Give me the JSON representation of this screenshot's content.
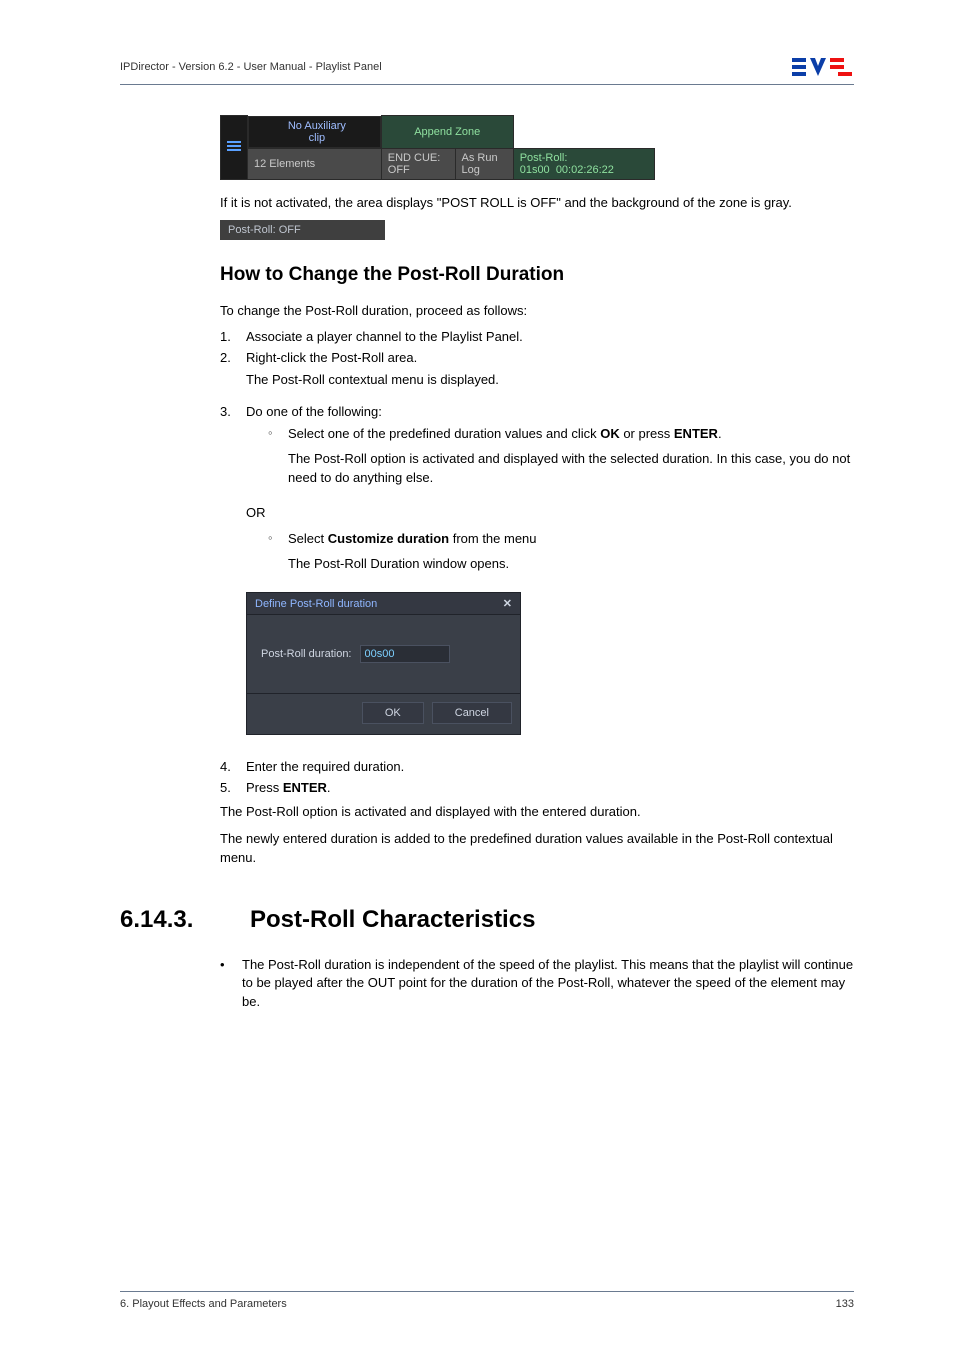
{
  "header": {
    "left": "IPDirector - Version 6.2 - User Manual - Playlist Panel"
  },
  "ui_bar": {
    "aux_label": "No Auxiliary clip",
    "append_label": "Append Zone",
    "elements": "12 Elements",
    "end_cue": "END CUE: OFF",
    "as_run": "As Run Log",
    "post_roll": "Post-Roll: 01s00",
    "timecode": "00:02:26:22"
  },
  "para_off": "If it is not activated, the area displays \"POST ROLL is OFF\" and the background of the zone is gray.",
  "post_roll_off_chip": "Post-Roll: OFF",
  "howto_heading": "How to Change the Post-Roll Duration",
  "howto_intro": "To change the Post-Roll duration, proceed as follows:",
  "steps": [
    {
      "n": "1.",
      "text": "Associate a player channel to the Playlist Panel."
    },
    {
      "n": "2.",
      "text": "Right-click the Post-Roll area."
    }
  ],
  "step2_sub": "The Post-Roll contextual menu is displayed.",
  "step3_lead": "Do one of the following:",
  "step3_n": "3.",
  "step3_sub1_pre": "Select one of the predefined duration values and click ",
  "ok_word": "OK",
  "or_press": " or press ",
  "enter_word": "ENTER",
  "step3_sub1_post": ".",
  "step3_sub1_expl": "The Post-Roll option is activated and displayed with the selected duration. In this case, you do not need to do anything else.",
  "or_label": "OR",
  "step3_sub2_pre": "Select ",
  "customize_word": "Customize duration",
  "step3_sub2_post": " from the menu",
  "step3_sub2_expl": "The Post-Roll Duration window opens.",
  "dialog": {
    "title": "Define Post-Roll duration",
    "field_label": "Post-Roll duration:",
    "field_value": "00s00",
    "ok": "OK",
    "cancel": "Cancel"
  },
  "step4": {
    "n": "4.",
    "text": "Enter the required duration."
  },
  "step5": {
    "n": "5.",
    "pre": "Press ",
    "enter": "ENTER",
    "post": "."
  },
  "after1": "The Post-Roll option is activated and displayed with the entered duration.",
  "after2": "The newly entered duration is added to the predefined duration values available in the Post-Roll contextual menu.",
  "section": {
    "num": "6.14.3.",
    "title": "Post-Roll Characteristics"
  },
  "char_bullet": "The Post-Roll duration is independent of the speed of the playlist. This means that the playlist will continue to be played after the OUT point for the duration of the Post-Roll, whatever the speed of the element may be.",
  "footer": {
    "left": "6. Playout Effects and Parameters",
    "right": "133"
  }
}
